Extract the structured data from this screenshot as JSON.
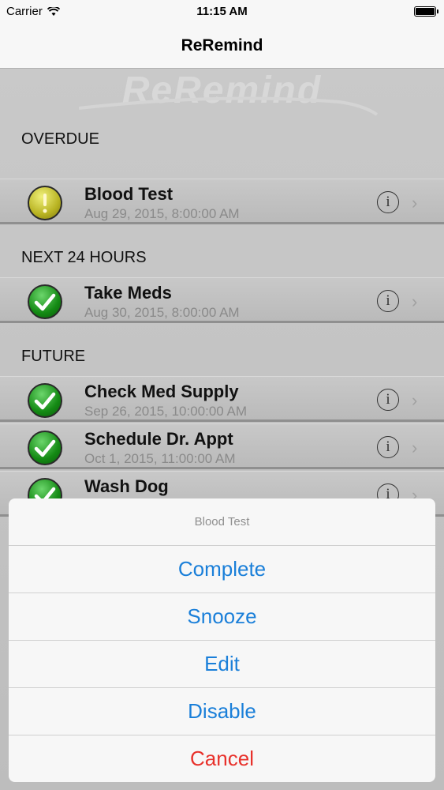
{
  "status_bar": {
    "carrier": "Carrier",
    "time": "11:15 AM",
    "battery_level": 1.0
  },
  "nav": {
    "title": "ReRemind"
  },
  "watermark": {
    "text": "ReRemind"
  },
  "sections": [
    {
      "header": "OVERDUE",
      "items": [
        {
          "title": "Blood Test",
          "subtitle": "Aug 29, 2015, 8:00:00 AM",
          "status_icon": "warning-icon",
          "status_color": "#b8b322"
        }
      ]
    },
    {
      "header": "NEXT 24 HOURS",
      "items": [
        {
          "title": "Take Meds",
          "subtitle": "Aug 30, 2015, 8:00:00 AM",
          "status_icon": "checkmark-icon",
          "status_color": "#148a14"
        }
      ]
    },
    {
      "header": "FUTURE",
      "items": [
        {
          "title": "Check Med Supply",
          "subtitle": "Sep 26, 2015, 10:00:00 AM",
          "status_icon": "checkmark-icon",
          "status_color": "#148a14"
        },
        {
          "title": "Schedule Dr. Appt",
          "subtitle": "Oct 1, 2015, 11:00:00 AM",
          "status_icon": "checkmark-icon",
          "status_color": "#148a14"
        },
        {
          "title": "Wash Dog",
          "subtitle": "",
          "status_icon": "checkmark-icon",
          "status_color": "#148a14"
        }
      ]
    }
  ],
  "action_sheet": {
    "title": "Blood Test",
    "buttons": [
      "Complete",
      "Snooze",
      "Edit",
      "Disable"
    ],
    "cancel": "Cancel",
    "button_color": "#1a7fd9",
    "cancel_color": "#e8312b"
  }
}
